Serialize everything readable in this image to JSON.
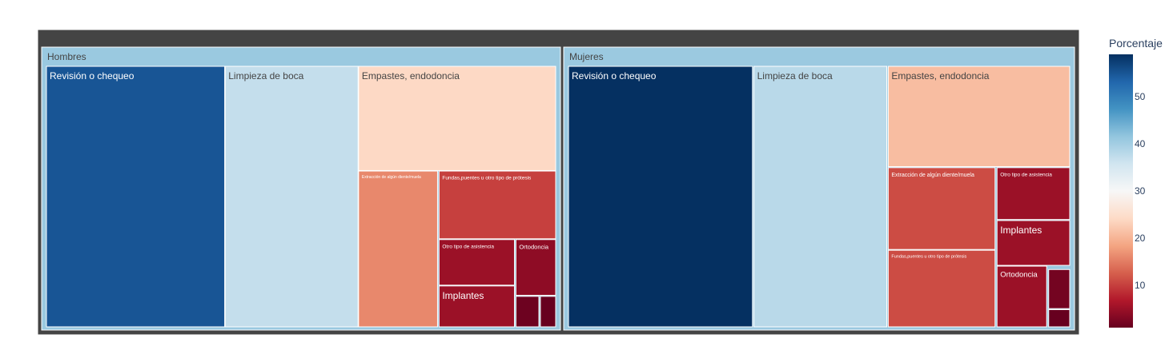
{
  "chart_data": {
    "type": "treemap",
    "title": "",
    "colorbar": {
      "title": "Porcentaje",
      "range": [
        1,
        59
      ],
      "ticks": [
        10,
        20,
        30,
        40,
        50
      ],
      "colorscale": [
        "#67001f",
        "#b2182b",
        "#d6604d",
        "#f4a582",
        "#fddbc7",
        "#f7f7f7",
        "#d1e5f0",
        "#92c5de",
        "#4393c3",
        "#2166ac",
        "#053061"
      ]
    },
    "groups": [
      {
        "name": "Hombres",
        "items": [
          {
            "label": "Revisión o chequeo",
            "value": 55
          },
          {
            "label": "Limpieza de boca",
            "value": 37
          },
          {
            "label": "Empastes, endodoncia",
            "value": 24
          },
          {
            "label": "Extracción de algún diente/muela",
            "value": 16
          },
          {
            "label": "Fundas,puentes u otro tipo de prótesis",
            "value": 10
          },
          {
            "label": "Otro tipo de asistencia",
            "value": 5
          },
          {
            "label": "Implantes",
            "value": 5
          },
          {
            "label": "Ortodoncia",
            "value": 4
          },
          {
            "label": "",
            "value": 1.5
          },
          {
            "label": "",
            "value": 1
          }
        ]
      },
      {
        "name": "Mujeres",
        "items": [
          {
            "label": "Revisión o chequeo",
            "value": 59
          },
          {
            "label": "Limpieza de boca",
            "value": 38
          },
          {
            "label": "Empastes, endodoncia",
            "value": 21
          },
          {
            "label": "Extracción de algún diente/muela",
            "value": 11
          },
          {
            "label": "Fundas,puentes u otro tipo de prótesis",
            "value": 11
          },
          {
            "label": "Otro tipo de asistencia",
            "value": 5
          },
          {
            "label": "Implantes",
            "value": 5
          },
          {
            "label": "Ortodoncia",
            "value": 5
          },
          {
            "label": "",
            "value": 2
          },
          {
            "label": "",
            "value": 1
          }
        ]
      }
    ]
  }
}
